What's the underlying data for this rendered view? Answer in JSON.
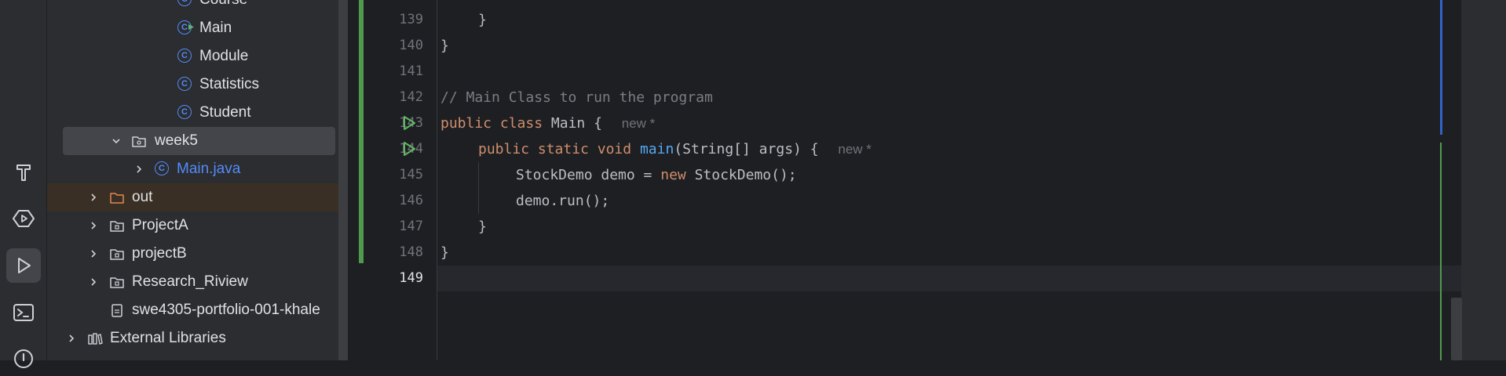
{
  "activity_bar": {
    "items": [
      {
        "name": "build-icon"
      },
      {
        "name": "services-icon"
      },
      {
        "name": "run-icon",
        "active": true
      },
      {
        "name": "terminal-icon"
      },
      {
        "name": "problems-icon"
      }
    ]
  },
  "project_tree": {
    "items": [
      {
        "label": "Course",
        "type": "class"
      },
      {
        "label": "Main",
        "type": "class-main"
      },
      {
        "label": "Module",
        "type": "class"
      },
      {
        "label": "Statistics",
        "type": "class"
      },
      {
        "label": "Student",
        "type": "class"
      },
      {
        "label": "week5",
        "type": "package",
        "expanded": true
      },
      {
        "label": "Main.java",
        "type": "class-file"
      },
      {
        "label": "out",
        "type": "folder-excluded"
      },
      {
        "label": "ProjectA",
        "type": "module"
      },
      {
        "label": "projectB",
        "type": "module"
      },
      {
        "label": "Research_Riview",
        "type": "module"
      },
      {
        "label": "swe4305-portfolio-001-khale",
        "type": "iml-file"
      },
      {
        "label": "External Libraries",
        "type": "libraries"
      }
    ]
  },
  "editor": {
    "line_numbers": [
      "139",
      "140",
      "141",
      "142",
      "143",
      "144",
      "145",
      "146",
      "147",
      "148",
      "149"
    ],
    "current_line": "149",
    "inlay_hint": "new *",
    "lines": {
      "l139": "}",
      "l140": "}",
      "l142": "// Main Class to run the program",
      "l143_kw1": "public",
      "l143_kw2": "class",
      "l143_rest": " Main { ",
      "l144_kw1": "public",
      "l144_kw2": "static",
      "l144_kw3": "void",
      "l144_fn": "main",
      "l144_rest": "(String[] args) { ",
      "l145_a": "StockDemo demo = ",
      "l145_kw": "new",
      "l145_b": " StockDemo();",
      "l146": "demo.run();",
      "l147": "}",
      "l148": "}"
    }
  },
  "colors": {
    "accent": "#548af7",
    "keyword": "#cf8e6d",
    "function": "#56a8f5",
    "comment": "#7a7e85",
    "vcs_added": "#4f9a4f"
  }
}
